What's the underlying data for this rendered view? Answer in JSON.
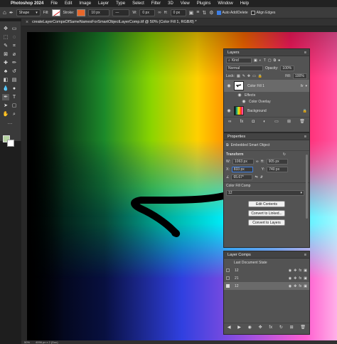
{
  "menubar": {
    "apple": "",
    "app_name": "Photoshop 2024",
    "items": [
      "File",
      "Edit",
      "Image",
      "Layer",
      "Type",
      "Select",
      "Filter",
      "3D",
      "View",
      "Plugins",
      "Window",
      "Help"
    ]
  },
  "options_bar": {
    "mode": "Shape",
    "fill_label": "Fill:",
    "stroke_label": "Stroke:",
    "stroke_width": "10 px",
    "width_label": "W:",
    "width_value": "0 px",
    "height_label": "H:",
    "height_value": "0 px",
    "auto_add_delete": "Auto Add/Delete",
    "align_edges": "Align Edges"
  },
  "document": {
    "tab_title": "createLayerCompsOfSameNamesForSmartObjectLayerComp.tif @ 50% (Color Fill 1, RGB/8) *"
  },
  "status": {
    "zoom": "50%",
    "info": "4096 px x 2 (Doc)"
  },
  "layers_panel": {
    "tab": "Layers",
    "kind": "Kind",
    "blend_mode": "Normal",
    "opacity_label": "Opacity:",
    "opacity": "100%",
    "lock_label": "Lock:",
    "fill_label": "Fill:",
    "fill": "100%",
    "layers": [
      {
        "name": "Color Fill 1",
        "fx": "fx"
      },
      {
        "name": "Background"
      }
    ],
    "effects_label": "Effects",
    "effect_item": "Color Overlay"
  },
  "properties_panel": {
    "tab": "Properties",
    "type": "Embedded Smart Object",
    "transform_label": "Transform",
    "w_label": "W:",
    "w_value": "1063 px",
    "h_label": "H:",
    "h_value": "905 px",
    "x_label": "X:",
    "x_value": "833 px",
    "y_label": "Y:",
    "y_value": "740 px",
    "angle": "65.67°",
    "comp_label": "Color Fill Comp",
    "comp_value": "12",
    "buttons": [
      "Edit Contents",
      "Convert to Linked...",
      "Convert to Layers"
    ]
  },
  "layer_comps_panel": {
    "tab": "Layer Comps",
    "comps": [
      "Last Document State",
      "12",
      "21",
      "12"
    ]
  },
  "colors": {
    "foreground": "#b5d3a1",
    "background": "#ffffff",
    "selection": "#6a6a6a"
  }
}
